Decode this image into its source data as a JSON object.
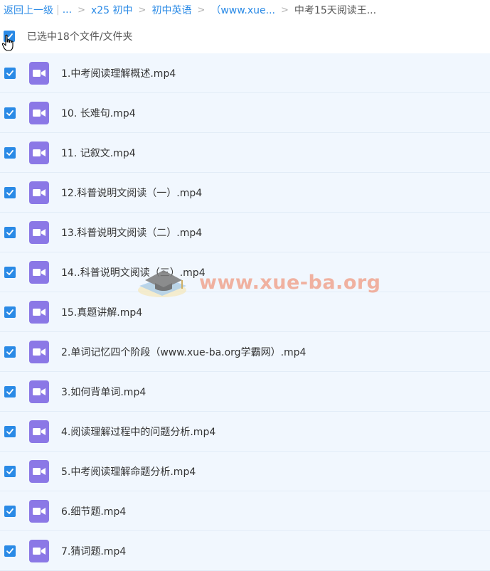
{
  "breadcrumb": {
    "back": "返回上一级",
    "ellipsis": "...",
    "items": [
      "x25 初中",
      "初中英语",
      "（www.xue...",
      "中考15天阅读王..."
    ]
  },
  "selection": {
    "text": "已选中18个文件/文件夹"
  },
  "files": [
    "1.中考阅读理解概述.mp4",
    "10. 长难句.mp4",
    "11. 记叙文.mp4",
    "12.科普说明文阅读（一）.mp4",
    "13.科普说明文阅读（二）.mp4",
    "14..科普说明文阅读（三）.mp4",
    "15.真题讲解.mp4",
    "2.单词记忆四个阶段（www.xue-ba.org学霸网）.mp4",
    "3.如何背单词.mp4",
    "4.阅读理解过程中的问题分析.mp4",
    "5.中考阅读理解命题分析.mp4",
    "6.细节题.mp4",
    "7.猜词题.mp4"
  ],
  "watermark": "www.xue-ba.org",
  "colors": {
    "accent": "#2a8ae6",
    "video_icon": "#8b78e6",
    "row_bg": "#f1f7fe"
  },
  "icons": {
    "checkbox": "check-icon",
    "file": "video-file-icon",
    "cursor": "hand-pointer-icon"
  }
}
